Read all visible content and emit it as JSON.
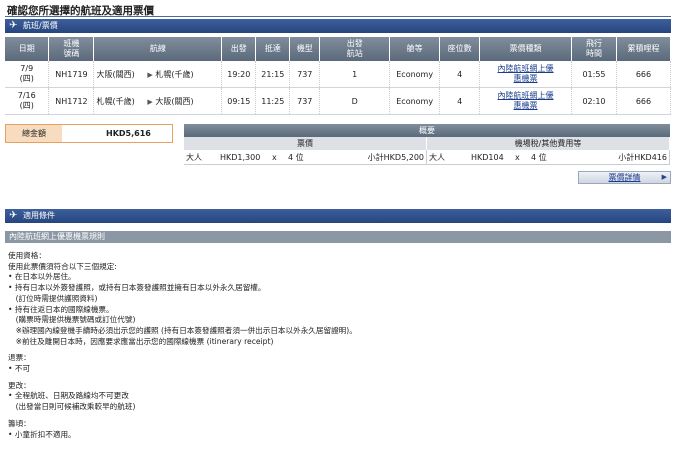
{
  "page_title": "確認您所選擇的航班及適用票價",
  "section_flights": "航班/票價",
  "flight_headers": [
    "日期",
    "班機\n號碼",
    "航線",
    "出發",
    "抵達",
    "機型",
    "出發\n航站",
    "艙等",
    "座位數",
    "票價種類",
    "飛行\n時間",
    "累積哩程"
  ],
  "flights": [
    {
      "date": "7/9\n(四)",
      "flight": "NH1719",
      "from": "大阪(關西)",
      "to": "札幌(千歲)",
      "dep": "19:20",
      "arr": "21:15",
      "type": "737",
      "term": "1",
      "cabin": "Economy",
      "seats": "4",
      "fare": "內陸航班網上優\n惠機票",
      "dur": "01:55",
      "miles": "666"
    },
    {
      "date": "7/16\n(四)",
      "flight": "NH1712",
      "from": "札幌(千歲)",
      "to": "大阪(關西)",
      "dep": "09:15",
      "arr": "11:25",
      "type": "737",
      "term": "D",
      "cabin": "Economy",
      "seats": "4",
      "fare": "內陸航班網上優\n惠機票",
      "dur": "02:10",
      "miles": "666"
    }
  ],
  "arrow_glyph": "▶",
  "total": {
    "label": "總金額",
    "value": "HKD5,616"
  },
  "summary": {
    "title": "概要",
    "fare_label": "票價",
    "tax_label": "機場稅/其他費用等",
    "fare_row": {
      "pax": "大人",
      "amount": "HKD1,300",
      "x": "x",
      "count": "4 位",
      "subtotal": "小計HKD5,200"
    },
    "tax_row": {
      "pax": "大人",
      "amount": "HKD104",
      "x": "x",
      "count": "4 位",
      "subtotal": "小計HKD416"
    },
    "detail_button": "票價詳情"
  },
  "section_conditions": "適用條件",
  "rules_title": "內陸航班網上優惠機票規則",
  "rules": [
    "使用資格：",
    "使用此票價須符合以下三個規定:",
    "• 在日本以外居住。",
    "• 持有日本以外簽發護照，或持有日本簽發護照並擁有日本以外永久居留權。",
    "　(訂位時需提供護照資料)",
    "• 持有往返日本的國際線機票。",
    "　(購票時需提供機票號碼或訂位代號)",
    "　※辦理國內線登機手續時必須出示您的護照 (持有日本簽發護照者須一併出示日本以外永久居留證明)。",
    "　※前往及離開日本時，因應要求應當出示您的國際線機票 (itinerary receipt)",
    "",
    "退票：",
    "• 不可",
    "",
    "更改：",
    "• 全程航班、日期及路線均不可更改",
    "　(出發當日則可候補改乘較早的航班)",
    "",
    "籌頃：",
    "• 小童折扣不適用。"
  ]
}
